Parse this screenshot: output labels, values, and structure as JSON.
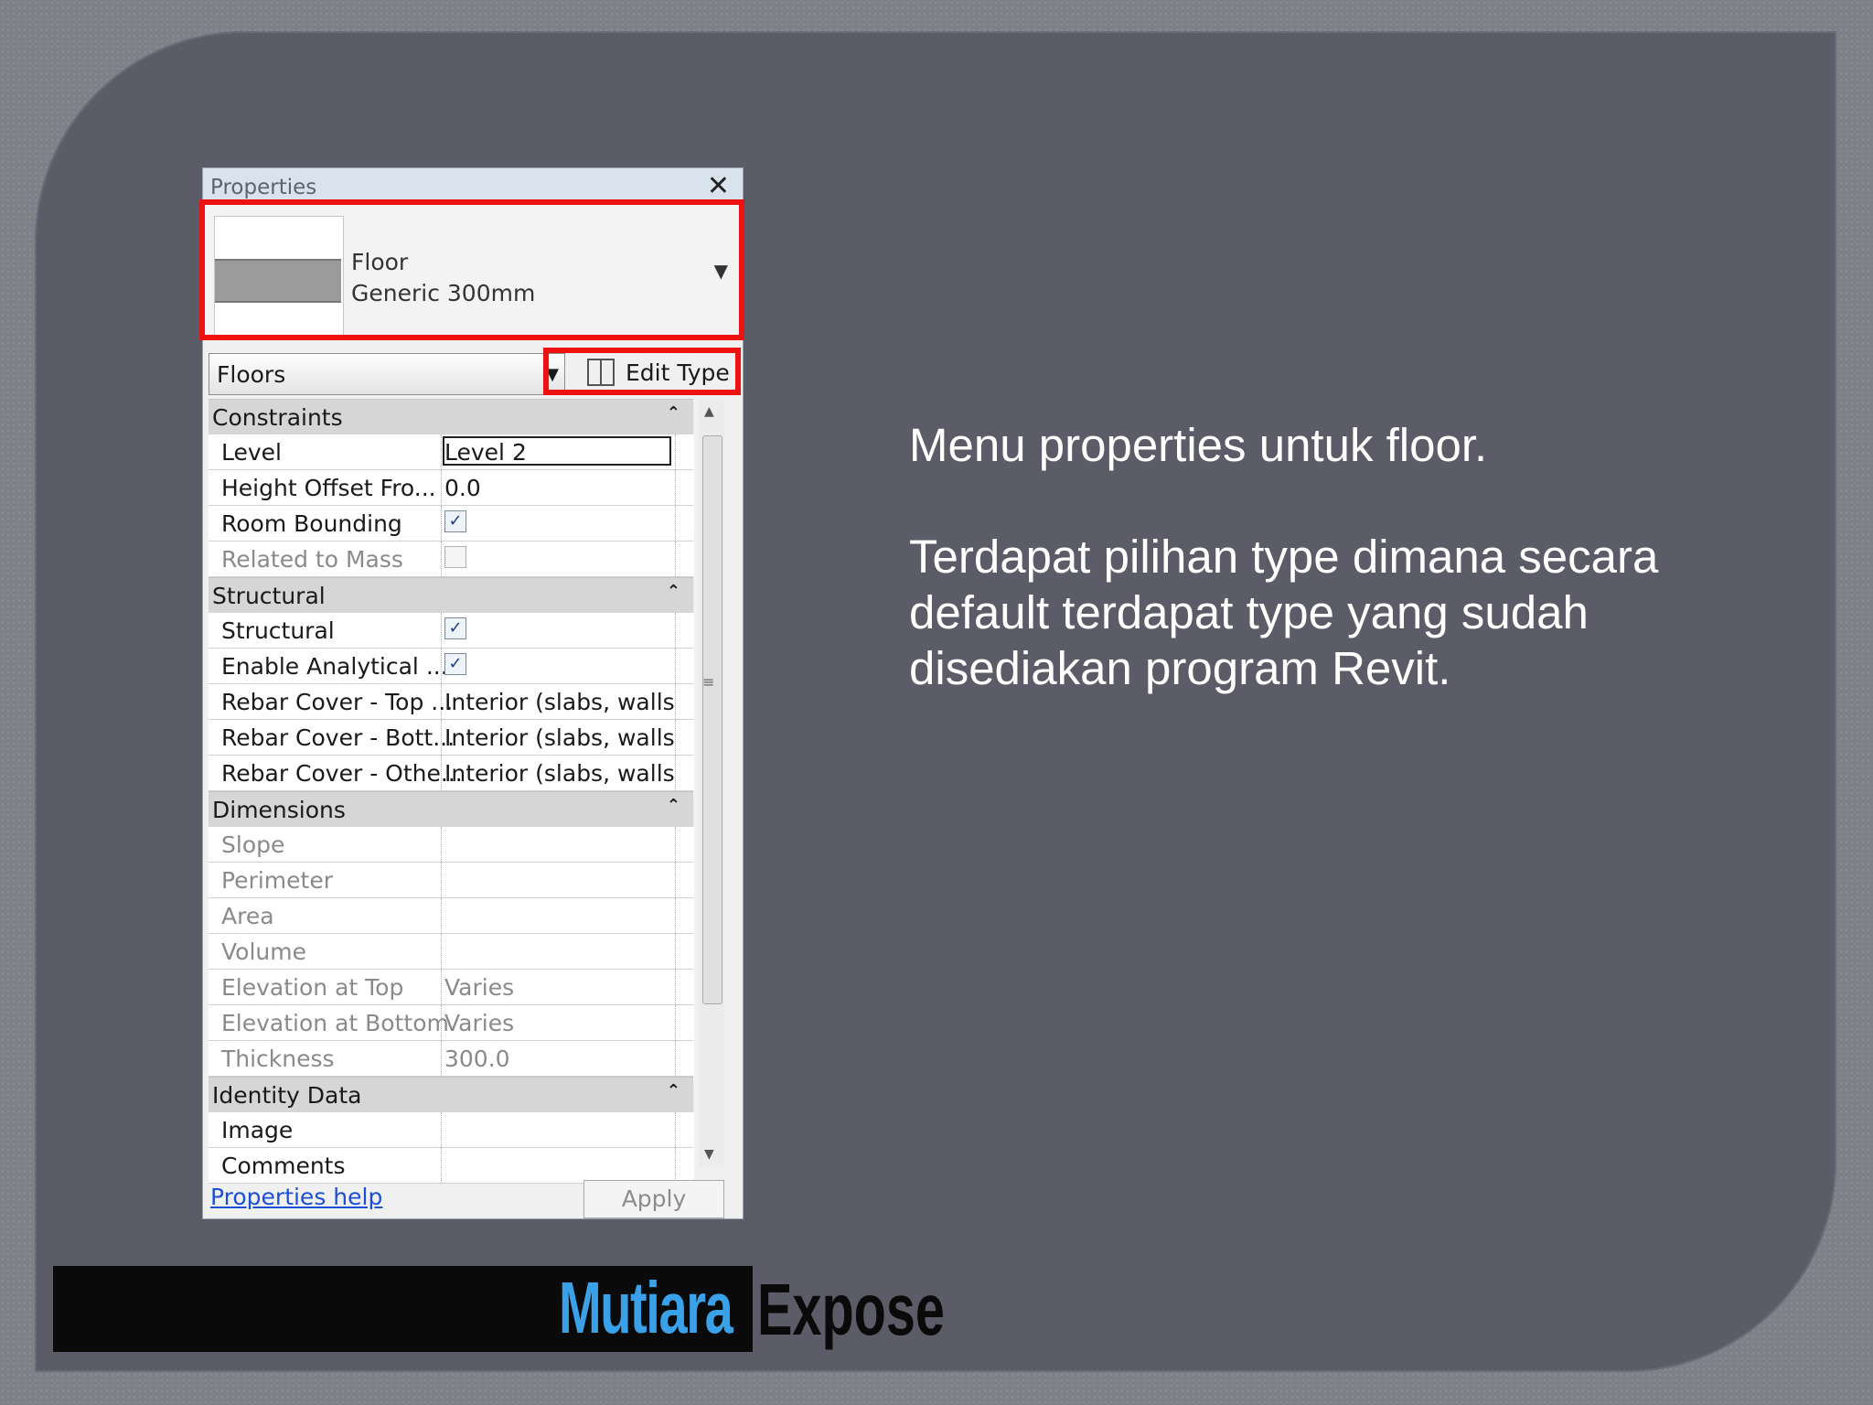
{
  "panel": {
    "title": "Properties",
    "close": "✕",
    "type_name": "Floor",
    "type_sub": "Generic 300mm",
    "category": "Floors",
    "edit_type": "Edit Type",
    "help": "Properties help",
    "apply": "Apply"
  },
  "sections": [
    {
      "label": "Constraints",
      "rows": [
        {
          "name": "Level",
          "value": "Level 2",
          "kind": "active"
        },
        {
          "name": "Height Offset Fro...",
          "value": "0.0",
          "kind": "text"
        },
        {
          "name": "Room Bounding",
          "value": "",
          "kind": "check",
          "checked": true
        },
        {
          "name": "Related to Mass",
          "value": "",
          "kind": "check-off",
          "checked": false,
          "disabled": true
        }
      ]
    },
    {
      "label": "Structural",
      "rows": [
        {
          "name": "Structural",
          "value": "",
          "kind": "check",
          "checked": true
        },
        {
          "name": "Enable Analytical ...",
          "value": "",
          "kind": "check",
          "checked": true
        },
        {
          "name": "Rebar Cover - Top ...",
          "value": "Interior (slabs, walls,...",
          "kind": "text"
        },
        {
          "name": "Rebar Cover - Bott...",
          "value": "Interior (slabs, walls,...",
          "kind": "text"
        },
        {
          "name": "Rebar Cover - Othe...",
          "value": "Interior (slabs, walls,...",
          "kind": "text"
        }
      ]
    },
    {
      "label": "Dimensions",
      "rows": [
        {
          "name": "Slope",
          "value": "",
          "kind": "text",
          "disabled": true
        },
        {
          "name": "Perimeter",
          "value": "",
          "kind": "text",
          "disabled": true
        },
        {
          "name": "Area",
          "value": "",
          "kind": "text",
          "disabled": true
        },
        {
          "name": "Volume",
          "value": "",
          "kind": "text",
          "disabled": true
        },
        {
          "name": "Elevation at Top",
          "value": "Varies",
          "kind": "text",
          "disabled": true
        },
        {
          "name": "Elevation at Bottom",
          "value": "Varies",
          "kind": "text",
          "disabled": true
        },
        {
          "name": "Thickness",
          "value": "300.0",
          "kind": "text",
          "disabled": true
        }
      ]
    },
    {
      "label": "Identity Data",
      "rows": [
        {
          "name": "Image",
          "value": "",
          "kind": "text"
        },
        {
          "name": "Comments",
          "value": "",
          "kind": "text"
        }
      ]
    }
  ],
  "description": {
    "line1": "Menu properties untuk floor.",
    "line2": "Terdapat pilihan type dimana secara default terdapat type yang sudah disediakan program Revit."
  },
  "logo": {
    "part1": "Mutiara",
    "part2": "Expose",
    "accent": "#3aa0e8"
  },
  "highlight_color": "#ee1111"
}
